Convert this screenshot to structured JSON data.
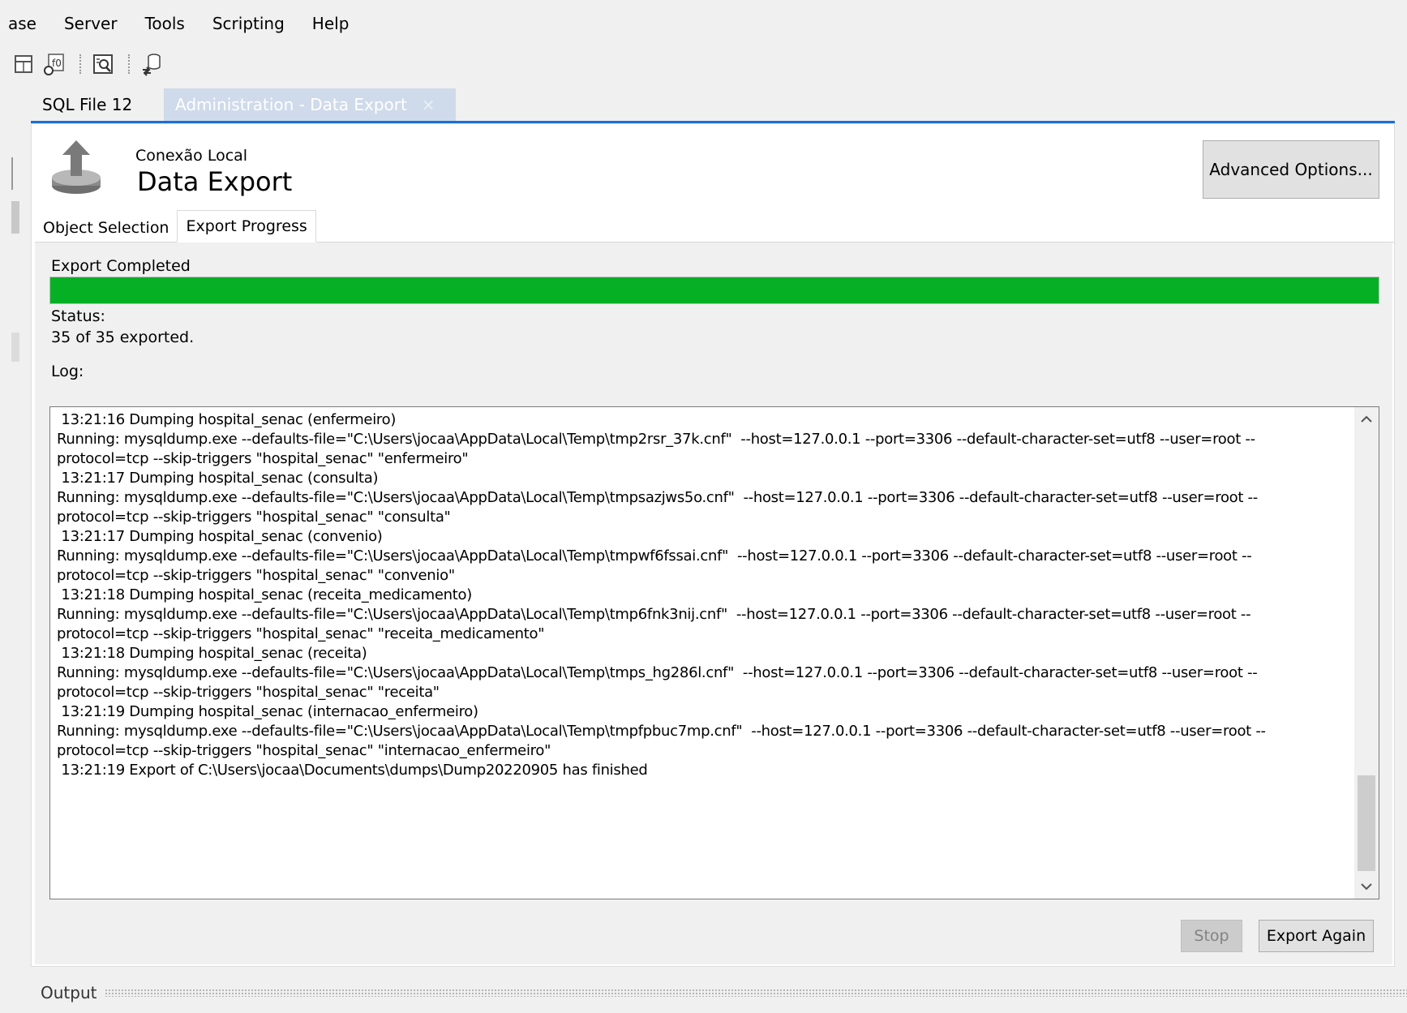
{
  "menu": [
    "ase",
    "Server",
    "Tools",
    "Scripting",
    "Help"
  ],
  "toolbar": {
    "icons": [
      "table-icon",
      "function-icon",
      "search-query-icon",
      "db-migrate-icon"
    ]
  },
  "tabs": [
    {
      "label": "SQL File 12",
      "active": false
    },
    {
      "label": "Administration - Data Export",
      "active": true,
      "close": "×"
    }
  ],
  "header": {
    "connection": "Conexão Local",
    "title": "Data Export",
    "advanced_button": "Advanced Options..."
  },
  "subtabs": [
    "Object Selection",
    "Export Progress"
  ],
  "progress": {
    "title": "Export Completed",
    "value": 1.0,
    "color": "#06b025"
  },
  "status": {
    "label": "Status:",
    "value": "35 of 35 exported."
  },
  "log": {
    "label": "Log:",
    "lines": [
      " 13:21:16 Dumping hospital_senac (enfermeiro)",
      "Running: mysqldump.exe --defaults-file=\"C:\\Users\\jocaa\\AppData\\Local\\Temp\\tmp2rsr_37k.cnf\"  --host=127.0.0.1 --port=3306 --default-character-set=utf8 --user=root --",
      "protocol=tcp --skip-triggers \"hospital_senac\" \"enfermeiro\"",
      " 13:21:17 Dumping hospital_senac (consulta)",
      "Running: mysqldump.exe --defaults-file=\"C:\\Users\\jocaa\\AppData\\Local\\Temp\\tmpsazjws5o.cnf\"  --host=127.0.0.1 --port=3306 --default-character-set=utf8 --user=root --",
      "protocol=tcp --skip-triggers \"hospital_senac\" \"consulta\"",
      " 13:21:17 Dumping hospital_senac (convenio)",
      "Running: mysqldump.exe --defaults-file=\"C:\\Users\\jocaa\\AppData\\Local\\Temp\\tmpwf6fssai.cnf\"  --host=127.0.0.1 --port=3306 --default-character-set=utf8 --user=root --",
      "protocol=tcp --skip-triggers \"hospital_senac\" \"convenio\"",
      " 13:21:18 Dumping hospital_senac (receita_medicamento)",
      "Running: mysqldump.exe --defaults-file=\"C:\\Users\\jocaa\\AppData\\Local\\Temp\\tmp6fnk3nij.cnf\"  --host=127.0.0.1 --port=3306 --default-character-set=utf8 --user=root --",
      "protocol=tcp --skip-triggers \"hospital_senac\" \"receita_medicamento\"",
      " 13:21:18 Dumping hospital_senac (receita)",
      "Running: mysqldump.exe --defaults-file=\"C:\\Users\\jocaa\\AppData\\Local\\Temp\\tmps_hg286l.cnf\"  --host=127.0.0.1 --port=3306 --default-character-set=utf8 --user=root --",
      "protocol=tcp --skip-triggers \"hospital_senac\" \"receita\"",
      " 13:21:19 Dumping hospital_senac (internacao_enfermeiro)",
      "Running: mysqldump.exe --defaults-file=\"C:\\Users\\jocaa\\AppData\\Local\\Temp\\tmpfpbuc7mp.cnf\"  --host=127.0.0.1 --port=3306 --default-character-set=utf8 --user=root --",
      "protocol=tcp --skip-triggers \"hospital_senac\" \"internacao_enfermeiro\"",
      " 13:21:19 Export of C:\\Users\\jocaa\\Documents\\dumps\\Dump20220905 has finished"
    ]
  },
  "buttons": {
    "stop": "Stop",
    "export_again": "Export Again"
  },
  "output": {
    "label": "Output"
  }
}
